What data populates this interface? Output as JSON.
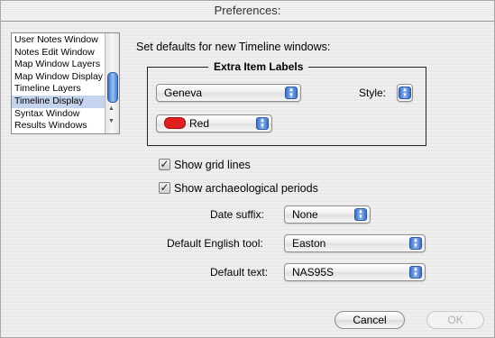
{
  "window": {
    "title": "Preferences:"
  },
  "sidebar": {
    "items": [
      "User Notes Window",
      "Notes Edit Window",
      "Map Window Layers",
      "Map Window Display",
      "Timeline Layers",
      "Timeline Display",
      "Syntax Window",
      "Results Windows"
    ],
    "selected": "Timeline Display"
  },
  "main": {
    "heading": "Set defaults for new Timeline windows:",
    "extra_item_labels": {
      "title": "Extra Item Labels",
      "font_value": "Geneva",
      "style_label": "Style:",
      "color_value": "Red",
      "color_hex": "#e02020"
    },
    "show_grid_lines": {
      "label": "Show grid lines",
      "checked": true
    },
    "show_archaeological_periods": {
      "label": "Show archaeological periods",
      "checked": true
    },
    "date_suffix": {
      "label": "Date suffix:",
      "value": "None"
    },
    "english_tool": {
      "label": "Default English tool:",
      "value": "Easton"
    },
    "default_text": {
      "label": "Default text:",
      "value": "NAS95S"
    }
  },
  "buttons": {
    "cancel": "Cancel",
    "ok": "OK"
  },
  "icons": {
    "check": "✓"
  }
}
